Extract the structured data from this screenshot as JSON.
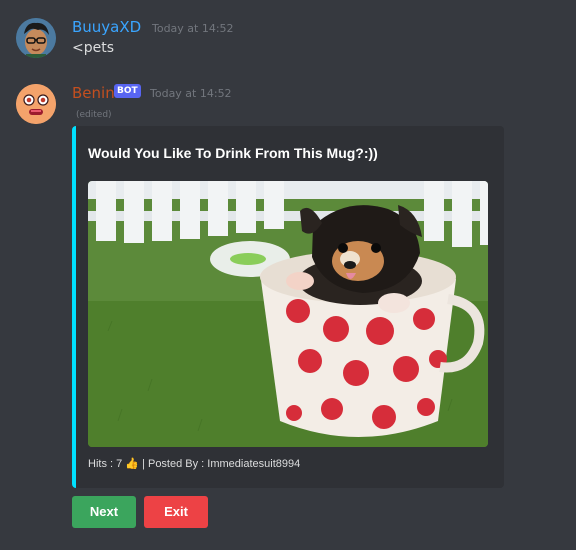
{
  "messages": [
    {
      "username": "BuuyaXD",
      "timestamp": "Today at 14:52",
      "text": "<pets",
      "name_color": "#3aa5ff"
    },
    {
      "username": "Benin",
      "bot_tag": "BOT",
      "timestamp": "Today at 14:52",
      "edited": "(edited)",
      "name_color": "#c34f1f",
      "embed": {
        "title": "Would You Like To Drink From This Mug?:))",
        "accent_color": "#00e1ff",
        "image": "puppy-in-polka-dot-mug",
        "footer_hits_label": "Hits : 7",
        "footer_hits_emoji": "👍",
        "footer_posted_by": "| Posted By : Immediatesuit8994"
      },
      "buttons": {
        "next_label": "Next",
        "exit_label": "Exit"
      }
    }
  ]
}
